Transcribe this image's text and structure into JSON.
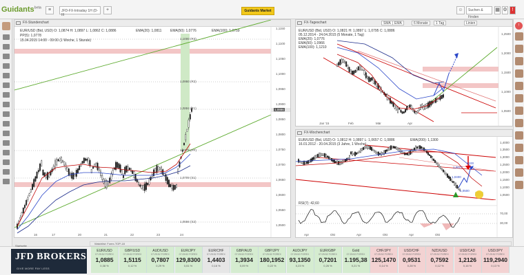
{
  "app": {
    "logo": "Guidants",
    "logo_badge": "beta",
    "tab_title": "JFD-FX-Intraday 1H (D-III",
    "guidants_button": "Guidants Market",
    "search_placeholder": "Suchen & Finden"
  },
  "left_chart": {
    "panel_title": "FX-Stundenchart",
    "info_line1": "EUR/USD (Bid, USD)  O: 1,0874  H: 1,0897  L: 1,0862  C: 1,0886",
    "info_line2": "PP(5): 1,0778",
    "info_line3": "15.04.2015 14:00 - 09:00 (1 Woche, 1 Stunde)",
    "ema20": "EMA(20): 1,0811",
    "ema50": "EMA(50): 1,0776",
    "ema100": "EMA(100): 1,0759",
    "levels": [
      {
        "label": "1,1000 (R3)"
      },
      {
        "label": "1,0950 (R2)"
      },
      {
        "label": "1,0884 (R1)"
      },
      {
        "label": "1,0779 (PP)"
      },
      {
        "label": "1,0709 (S1)"
      },
      {
        "label": "1,0556 (S2)"
      }
    ],
    "y_ticks": [
      "1,1150",
      "1,1100",
      "1,1050",
      "1,1000",
      "1,0950",
      "1,0900",
      "1,0850",
      "1,0800",
      "1,0750",
      "1,0700",
      "1,0650",
      "1,0600",
      "1,0550",
      "1,0500"
    ],
    "x_ticks": [
      "16",
      "17",
      "20",
      "21",
      "22",
      "23",
      "24"
    ],
    "last_price": "1,0886",
    "colors": {
      "ema20": "#c00000",
      "ema50": "#2b47c9",
      "ema100": "#1b2b8a",
      "resistance_zone": "#f3c6c6",
      "support_zone": "#f3c6c6",
      "up_zone": "#cfe9c6",
      "trend_line": "#5caa2d"
    }
  },
  "right_top_chart": {
    "panel_title": "FX-Tageschart",
    "info_line1": "EUR/USD (Bid, USD)  O: 1,0821  H: 1,0897  L: 1,0795  C: 1,0886",
    "info_line2": "05.12.2014 - 24.04.2015 (5 Monate, 1 Tag)",
    "ema20": "EMA(20): 1,0776",
    "ema50": "EMA(50): 1,0966",
    "ema100": "EMA(100): 1,1210",
    "toolbar": [
      "SMA",
      "EMA",
      "6 Monate",
      "1 Tag",
      "Linien"
    ],
    "x_ticks": [
      "Jan '15",
      "Feb",
      "Mär",
      "Apr"
    ],
    "y_ticks": [
      "1,2500",
      "1,2000",
      "1,1500",
      "1,1000",
      "1,0500"
    ]
  },
  "right_bottom_chart": {
    "panel_title": "FX-Wochenchart",
    "info_line1": "EUR/USD (Bid, USD)  O: 1,0812  H: 1,0897  L: 1,0657  C: 1,0886",
    "info_line2": "16.01.2012 - 20.04.2015 (3 Jahre, 1 Woche)",
    "ema200": "EMA(200): 1,1300",
    "annotations": [
      "1,0077",
      "2100",
      "1,0400",
      "1,0500"
    ],
    "rsi_label": "RSI(7): 42,60",
    "rsi_levels": [
      "70,00",
      "30,00"
    ],
    "x_ticks": [
      "Apr",
      "Okt",
      "Apr",
      "Okt",
      "Apr",
      "Okt"
    ],
    "y_ticks": [
      "1,4000",
      "1,3500",
      "1,3000",
      "1,2500",
      "1,2000",
      "1,1500",
      "1,1000",
      "1,0500"
    ]
  },
  "bottom": {
    "side_label": "Startseite",
    "broker_name": "JFD BROKERS",
    "broker_name_short": "JFD",
    "broker_word": "BROKERS",
    "broker_tagline": "GIVE MORE PAY LESS",
    "ticker_title": "Watchlist: Forex-TOP-18",
    "tiles": [
      {
        "name": "EUR/USD",
        "time": "07:25:52 FOREX",
        "value": "1,0885",
        "change": "0,38 %",
        "trend": "up"
      },
      {
        "name": "GBP/USD",
        "time": "07:25:52 FOREX",
        "value": "1,5115",
        "change": "0,12 %",
        "trend": "up"
      },
      {
        "name": "AUD/USD",
        "time": "07:25:52 FOREX",
        "value": "0,7807",
        "change": "0,29 %",
        "trend": "up"
      },
      {
        "name": "EUR/JPY",
        "time": "07:25:52 FOREX",
        "value": "129,8300",
        "change": "0,51 %",
        "trend": "up"
      },
      {
        "name": "EUR/CHF",
        "time": "07:25:52 FOREX",
        "value": "1,4403",
        "change": "0,16 %",
        "trend": "flat"
      },
      {
        "name": "GBP/AUD",
        "time": "07:25:52 FOREX",
        "value": "1,3934",
        "change": "0,09 %",
        "trend": "up"
      },
      {
        "name": "GBP/JPY",
        "time": "07:25:52 FOREX",
        "value": "180,1952",
        "change": "0,22 %",
        "trend": "up"
      },
      {
        "name": "AUD/JPY",
        "time": "07:25:52 FOREX",
        "value": "93,1350",
        "change": "0,23 %",
        "trend": "up"
      },
      {
        "name": "EUR/GBP",
        "time": "07:25:52 FOREX",
        "value": "0,7201",
        "change": "0,26 %",
        "trend": "up"
      },
      {
        "name": "Gold",
        "time": "07:25:52 FOREX",
        "value": "1.195,38",
        "change": "0,21 %",
        "trend": "up"
      },
      {
        "name": "CHF/JPY",
        "time": "07:25:52 FOREX",
        "value": "125,1470",
        "change": "0,14 %",
        "trend": "down"
      },
      {
        "name": "USD/CHF",
        "time": "07:25:52 FOREX",
        "value": "0,9531",
        "change": "0,28 %",
        "trend": "down"
      },
      {
        "name": "NZD/USD",
        "time": "07:25:52 FOREX",
        "value": "0,7592",
        "change": "0,12 %",
        "trend": "down"
      },
      {
        "name": "USD/CAD",
        "time": "07:25:52 FOREX",
        "value": "1,2126",
        "change": "0,16 %",
        "trend": "down"
      },
      {
        "name": "USD/JPY",
        "time": "07:25:52 FOREX",
        "value": "119,2940",
        "change": "0,13 %",
        "trend": "down"
      }
    ]
  }
}
